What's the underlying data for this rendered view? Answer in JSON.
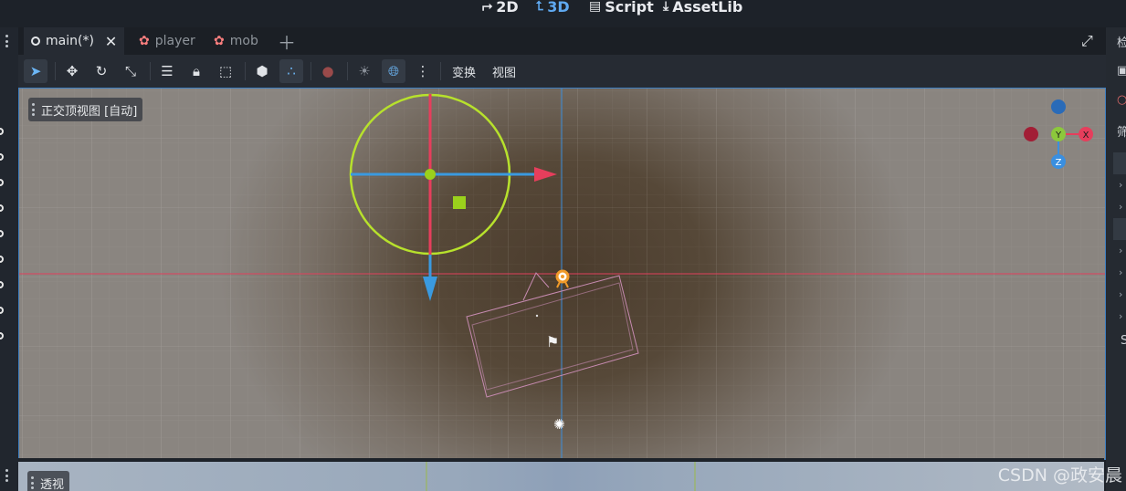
{
  "main_toolbar": {
    "modes": [
      {
        "label": "2D",
        "icon": "2d-icon",
        "active": false
      },
      {
        "label": "3D",
        "icon": "3d-icon",
        "active": true
      },
      {
        "label": "Script",
        "icon": "script-icon",
        "active": false
      },
      {
        "label": "AssetLib",
        "icon": "assetlib-icon",
        "active": false
      }
    ]
  },
  "scene_tabs": [
    {
      "label": "main(*)",
      "active": true
    },
    {
      "label": "player",
      "active": false
    },
    {
      "label": "mob",
      "active": false
    }
  ],
  "viewport_toolbar": {
    "menus": [
      "变换",
      "视图"
    ]
  },
  "viewport": {
    "top_label": "正交顶视图 [自动]",
    "gizmo_axes": [
      "Y",
      "X",
      "Z"
    ]
  },
  "bottom_viewport": {
    "label": "透视"
  },
  "right_dock": {
    "title_char": "检",
    "filter_char": "筛",
    "bottom_char": "S"
  },
  "watermark": "CSDN @政安晨",
  "colors": {
    "accent": "#5fa9f0",
    "x_axis": "#e8405a",
    "y_axis": "#8cc83c",
    "z_axis": "#3a8fe0",
    "gizmo_ring": "#b7e12c"
  }
}
